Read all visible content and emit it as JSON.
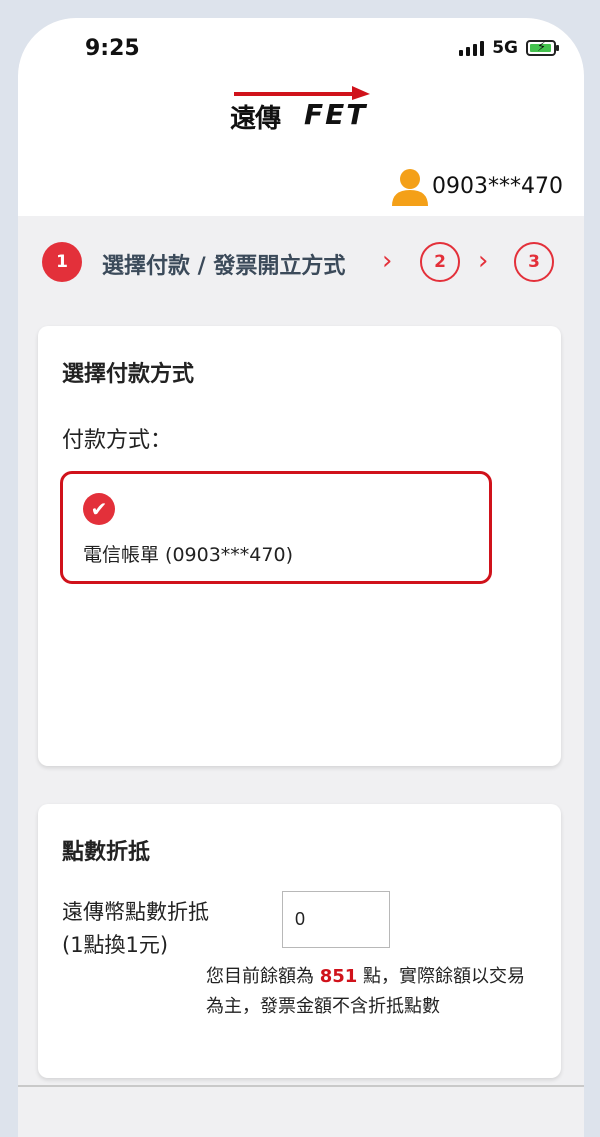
{
  "status_bar": {
    "time": "9:25",
    "network": "5G"
  },
  "brand": {
    "logo_cn": "遠傳",
    "logo_en": "FET"
  },
  "user": {
    "phone": "0903***470"
  },
  "steps": {
    "current_number": "1",
    "current_label": "選擇付款 / 發票開立方式",
    "step2": "2",
    "step3": "3"
  },
  "payment_card": {
    "title": "選擇付款方式",
    "method_label": "付款方式：",
    "selected_method": "電信帳單 (0903***470)"
  },
  "points_card": {
    "title": "點數折抵",
    "label_line1": "遠傳幣點數折抵",
    "label_line2": "(1點換1元)",
    "input_value": "0",
    "note_prefix": "您目前餘額為 ",
    "balance": "851",
    "note_suffix": " 點，實際餘額以交易為主，發票金額不含折抵點數"
  },
  "colors": {
    "accent": "#e3303a",
    "selected_border": "#d0121b",
    "step_text": "#3b4a5a"
  }
}
